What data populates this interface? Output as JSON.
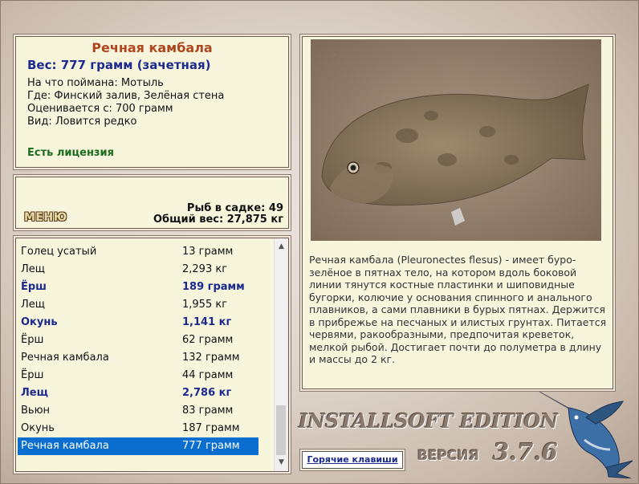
{
  "info": {
    "title": "Речная камбала",
    "weight": "Вес: 777 грамм (зачетная)",
    "bait": "На что поймана: Мотыль",
    "place": "Где: Финский залив, Зелёная стена",
    "rated": "Оценивается с: 700 грамм",
    "kind": "Вид: Ловится редко",
    "license": "Есть лицензия"
  },
  "stats": {
    "menu": "МЕНЮ",
    "cage": "Рыб в садке: 49",
    "total": "Общий вес: 27,875 кг"
  },
  "catch_list": [
    {
      "name": "Голец усатый",
      "weight": "13 грамм",
      "bold": false
    },
    {
      "name": "Лещ",
      "weight": "2,293 кг",
      "bold": false
    },
    {
      "name": "Ёрш",
      "weight": "189 грамм",
      "bold": true
    },
    {
      "name": "Лещ",
      "weight": "1,955 кг",
      "bold": false
    },
    {
      "name": "Окунь",
      "weight": "1,141 кг",
      "bold": true
    },
    {
      "name": "Ёрш",
      "weight": "62 грамм",
      "bold": false
    },
    {
      "name": "Речная камбала",
      "weight": "132 грамм",
      "bold": false
    },
    {
      "name": "Ёрш",
      "weight": "44 грамм",
      "bold": false
    },
    {
      "name": "Лещ",
      "weight": "2,786 кг",
      "bold": true
    },
    {
      "name": "Вьюн",
      "weight": "83 грамм",
      "bold": false
    },
    {
      "name": "Окунь",
      "weight": "187 грамм",
      "bold": false
    },
    {
      "name": "Речная камбала",
      "weight": "777 грамм",
      "bold": false,
      "selected": true
    }
  ],
  "description": "Речная камбала (Pleuronectes flesus) - имеет буро-зелёное в пятнах тело, на котором вдоль боковой линии тянутся костные пластинки и шиповидные бугорки, колючие у основания спинного и анального плавников, а сами плавники в бурых пятнах. Держится в прибрежье на песчаных и илистых грунтах. Питается червями, ракообразными, предпочитая креветок, мелкой рыбой. Достигает почти до полуметра в длину и массы до 2 кг.",
  "hotkeys": "Горячие клавиши",
  "edition": "INSTALLSOFT EDITION",
  "version_label": "ВЕРСИЯ",
  "version": "3.7.6",
  "colors": {
    "accent": "#b0461f",
    "bold_blue": "#1b2a8c",
    "selection": "#0a6ed1",
    "license": "#1d6b1d"
  }
}
